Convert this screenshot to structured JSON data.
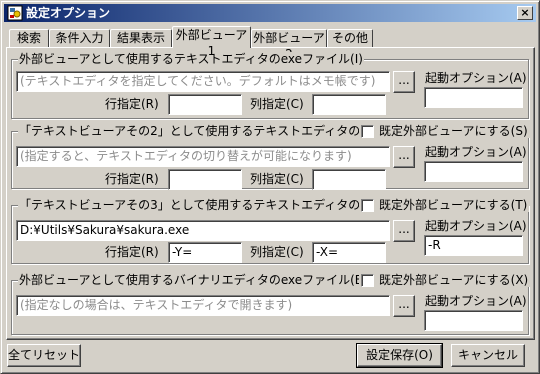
{
  "window": {
    "title": "設定オプション",
    "close_glyph": "×"
  },
  "tabs": [
    {
      "label": "検索"
    },
    {
      "label": "条件入力"
    },
    {
      "label": "結果表示"
    },
    {
      "label": "外部ビューア1",
      "active": true
    },
    {
      "label": "外部ビューア2"
    },
    {
      "label": "その他"
    }
  ],
  "groups": [
    {
      "legend": "外部ビューアとして使用するテキストエディタのexeファイル(I)",
      "path": "",
      "path_placeholder": "(テキストエディタを指定してください。デフォルトはメモ帳です)",
      "browse_label": "...",
      "row_label": "行指定(R)",
      "row_value": "",
      "col_label": "列指定(C)",
      "col_value": "",
      "startup_label": "起動オプション(A)",
      "startup_value": ""
    },
    {
      "legend": "「テキストビューアその2」として使用するテキストエディタのexeファイル(2)",
      "default_label": "既定外部ビューアにする(S)",
      "path": "",
      "path_placeholder": "(指定すると、テキストエディタの切り替えが可能になります)",
      "browse_label": "...",
      "row_label": "行指定(R)",
      "row_value": "",
      "col_label": "列指定(C)",
      "col_value": "",
      "startup_label": "起動オプション(A)",
      "startup_value": ""
    },
    {
      "legend": "「テキストビューアその3」として使用するテキストエディタのexeファイル(3)",
      "default_label": "既定外部ビューアにする(T)",
      "path": "D:¥Utils¥Sakura¥sakura.exe",
      "path_placeholder": "",
      "browse_label": "...",
      "row_label": "行指定(R)",
      "row_value": "-Y=",
      "col_label": "列指定(C)",
      "col_value": "-X=",
      "startup_label": "起動オプション(A)",
      "startup_value": "-R"
    },
    {
      "legend": "外部ビューアとして使用するバイナリエディタのexeファイル(B)",
      "default_label": "既定外部ビューアにする(X)",
      "path": "",
      "path_placeholder": "(指定なしの場合は、テキストエディタで開きます)",
      "browse_label": "...",
      "startup_label": "起動オプション(A)",
      "startup_value": ""
    }
  ],
  "buttons": {
    "reset_all": "全てリセット",
    "save": "設定保存(O)",
    "cancel": "キャンセル"
  }
}
